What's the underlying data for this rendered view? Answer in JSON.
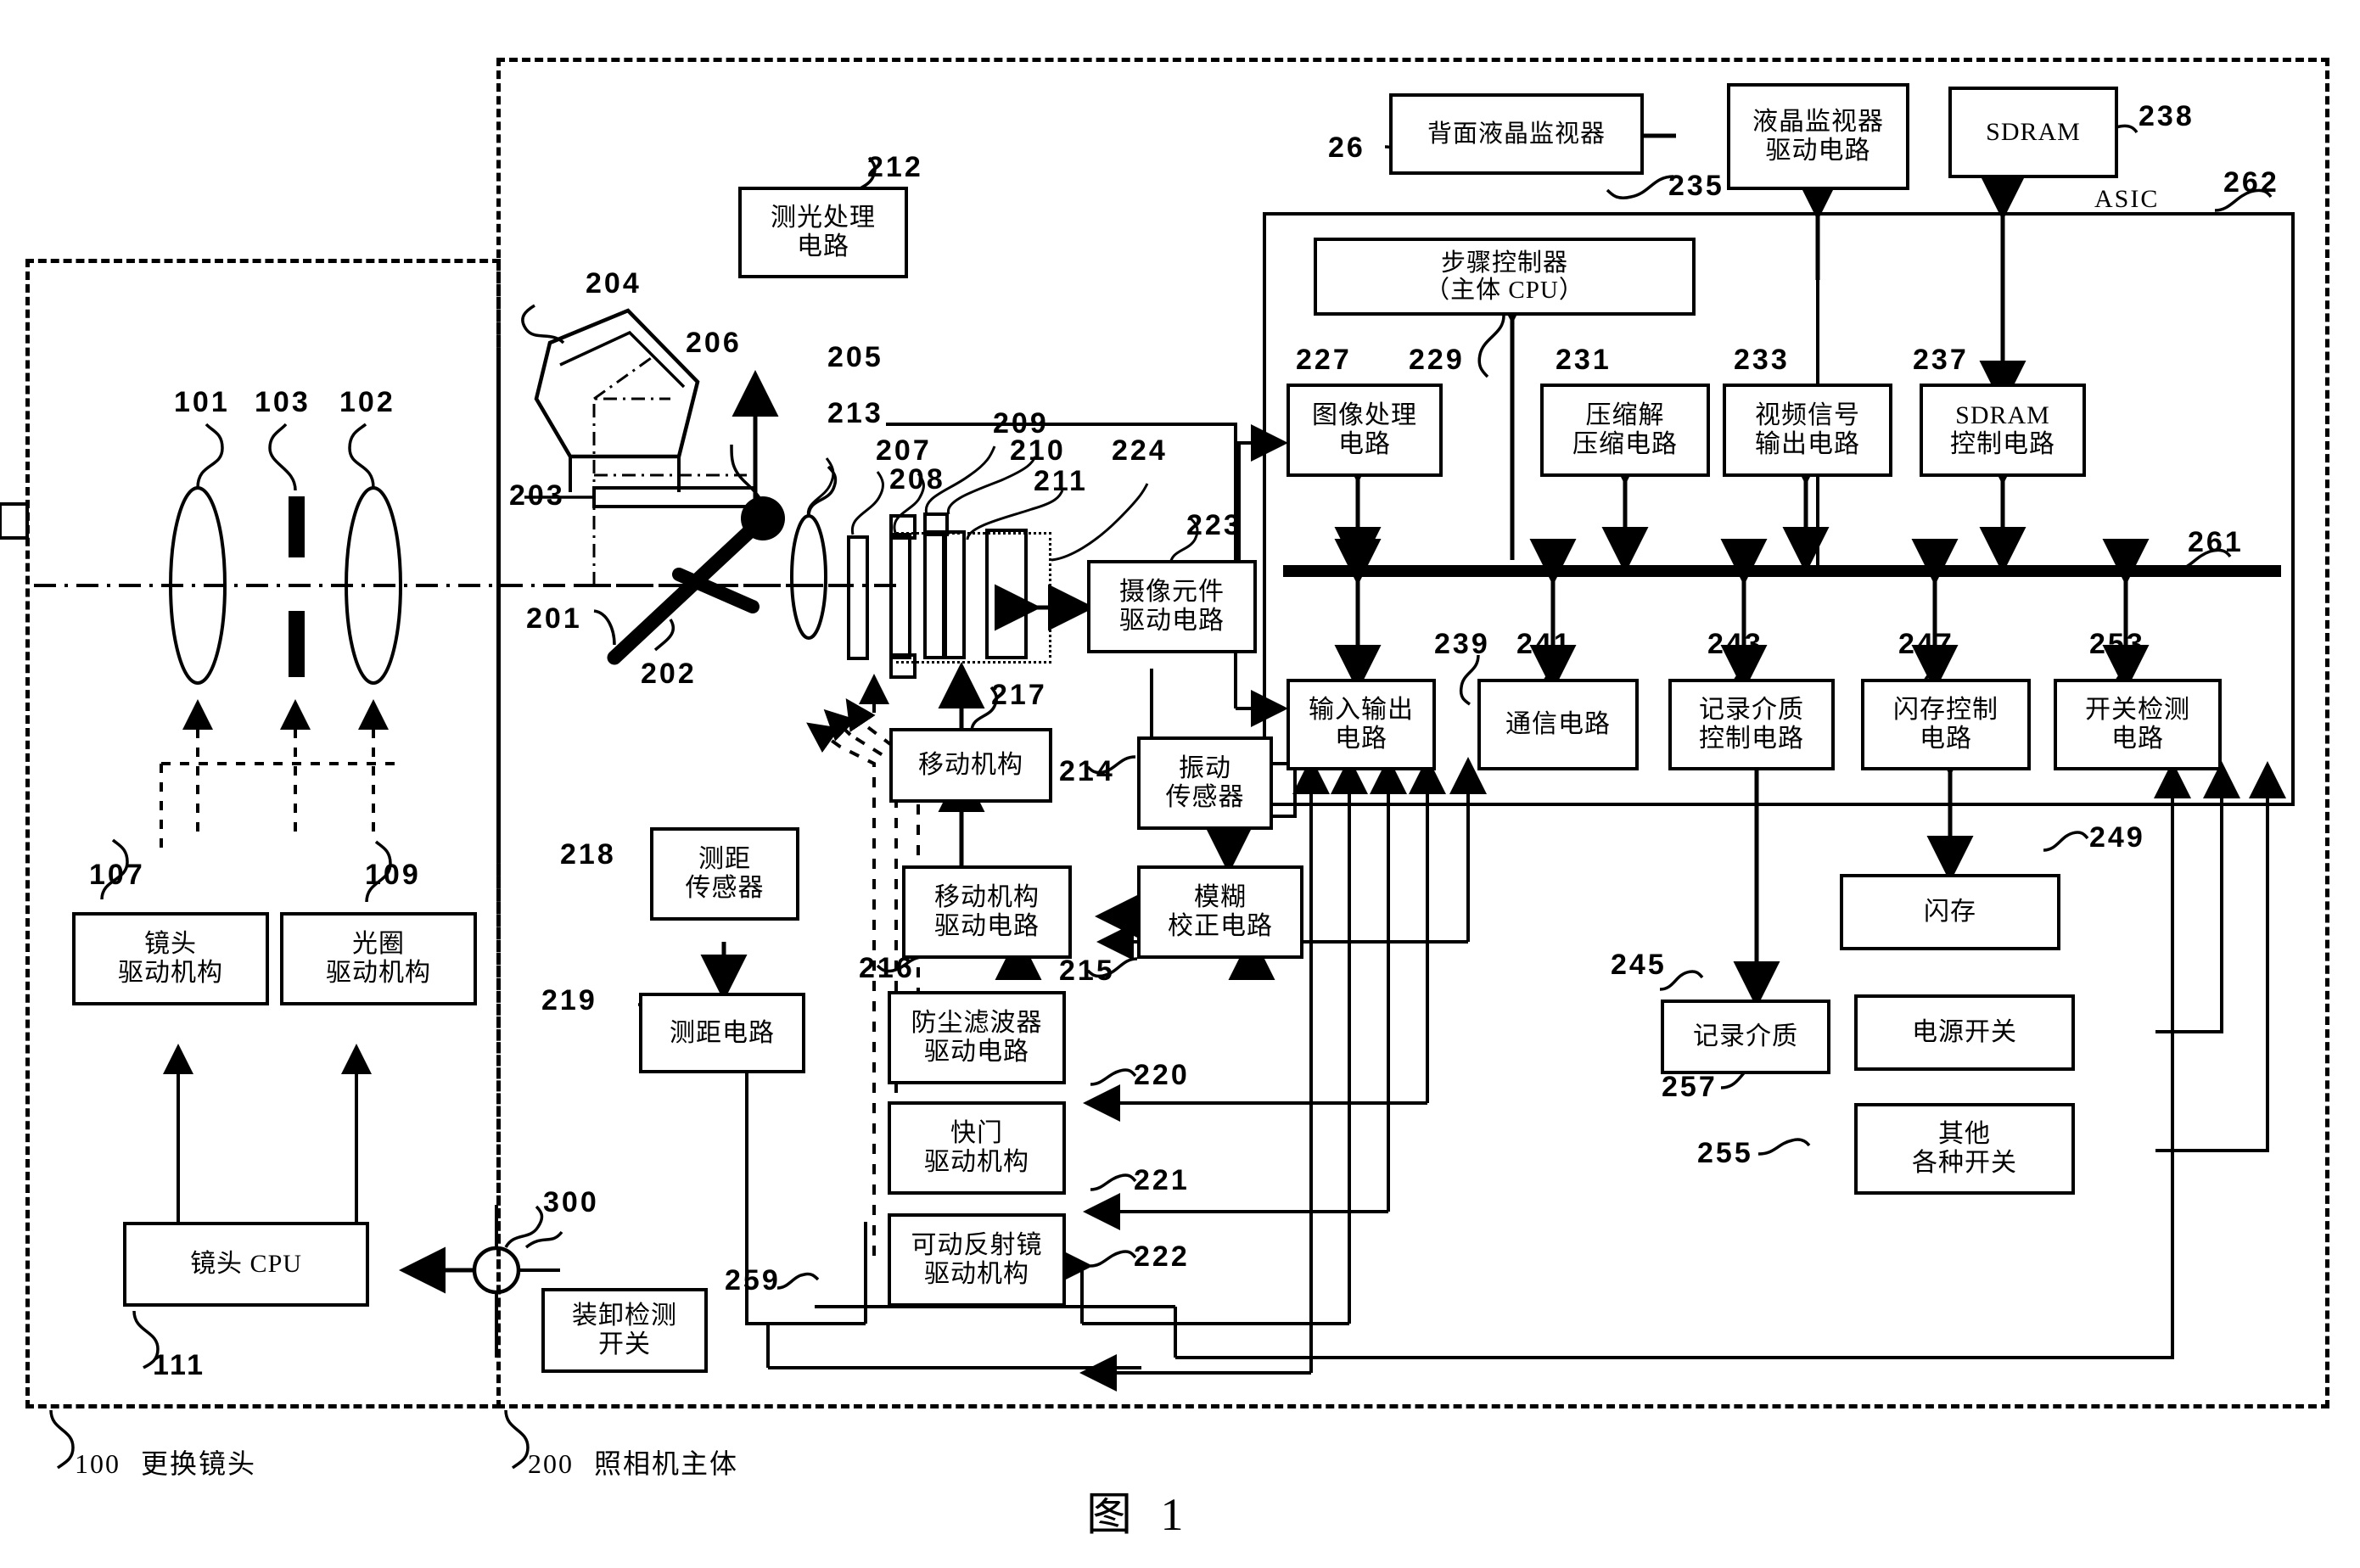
{
  "figure": {
    "caption": "图 1",
    "asic_label": "ASIC"
  },
  "groups": [
    {
      "ref": "100",
      "label": "更换镜头"
    },
    {
      "ref": "200",
      "label": "照相机主体"
    }
  ],
  "lens_unit": {
    "optics": [
      {
        "ref": "101",
        "kind": "lens-element"
      },
      {
        "ref": "103",
        "kind": "aperture-diaphragm"
      },
      {
        "ref": "102",
        "kind": "lens-element"
      }
    ],
    "blocks": [
      {
        "ref": "107",
        "label": "镜头\n驱动机构"
      },
      {
        "ref": "109",
        "label": "光圈\n驱动机构"
      },
      {
        "ref": "111",
        "label": "镜头 CPU"
      }
    ]
  },
  "body_optics": {
    "items": [
      {
        "ref": "201",
        "kind": "movable-mirror"
      },
      {
        "ref": "202",
        "kind": "sub-mirror"
      },
      {
        "ref": "203",
        "kind": "focusing-screen"
      },
      {
        "ref": "204",
        "kind": "pentaprism"
      },
      {
        "ref": "205",
        "kind": "eyepiece-lens"
      },
      {
        "ref": "206",
        "kind": "photometry-sensor"
      },
      {
        "ref": "207",
        "kind": "optical-plate"
      },
      {
        "ref": "208",
        "kind": "optical-plate"
      },
      {
        "ref": "209",
        "kind": "optical-plate"
      },
      {
        "ref": "210",
        "kind": "optical-plate"
      },
      {
        "ref": "211",
        "kind": "image-sensor"
      },
      {
        "ref": "213",
        "kind": "shutter"
      },
      {
        "ref": "224",
        "kind": "sensor-unit"
      }
    ]
  },
  "blocks": [
    {
      "ref": "212",
      "label": "测光处理\n电路"
    },
    {
      "ref": "223",
      "label": "摄像元件\n驱动电路"
    },
    {
      "ref": "26",
      "label": "背面液晶监视器"
    },
    {
      "ref": "235",
      "label": "液晶监视器\n驱动电路"
    },
    {
      "ref": "238",
      "label": "SDRAM"
    },
    {
      "ref": "229",
      "label": "步骤控制器\n（主体 CPU）"
    },
    {
      "ref": "227",
      "label": "图像处理\n电路"
    },
    {
      "ref": "231",
      "label": "压缩解\n压缩电路"
    },
    {
      "ref": "233",
      "label": "视频信号\n输出电路"
    },
    {
      "ref": "237",
      "label": "SDRAM\n控制电路"
    },
    {
      "ref": "239",
      "label": "输入输出\n电路"
    },
    {
      "ref": "241",
      "label": "通信电路"
    },
    {
      "ref": "243",
      "label": "记录介质\n控制电路"
    },
    {
      "ref": "247",
      "label": "闪存控制\n电路"
    },
    {
      "ref": "253",
      "label": "开关检测\n电路"
    },
    {
      "ref": "249",
      "label": "闪存"
    },
    {
      "ref": "245",
      "label": "记录介质"
    },
    {
      "ref": "257",
      "label": "电源开关"
    },
    {
      "ref": "255",
      "label": "其他\n各种开关"
    },
    {
      "ref": "217",
      "label": "移动机构"
    },
    {
      "ref": "214",
      "label": "振动\n传感器"
    },
    {
      "ref": "216",
      "label": "移动机构\n驱动电路"
    },
    {
      "ref": "215",
      "label": "模糊\n校正电路"
    },
    {
      "ref": "218",
      "label": "测距\n传感器"
    },
    {
      "ref": "219",
      "label": "测距电路"
    },
    {
      "ref": "220",
      "label": "防尘滤波器\n驱动电路"
    },
    {
      "ref": "221",
      "label": "快门\n驱动机构"
    },
    {
      "ref": "222",
      "label": "可动反射镜\n驱动机构"
    },
    {
      "ref": "259",
      "label": "装卸检测\n开关"
    }
  ],
  "buses": [
    {
      "ref": "261",
      "kind": "data-bus"
    },
    {
      "ref": "262",
      "kind": "asic-boundary"
    },
    {
      "ref": "300",
      "kind": "lens-mount-contact"
    }
  ]
}
